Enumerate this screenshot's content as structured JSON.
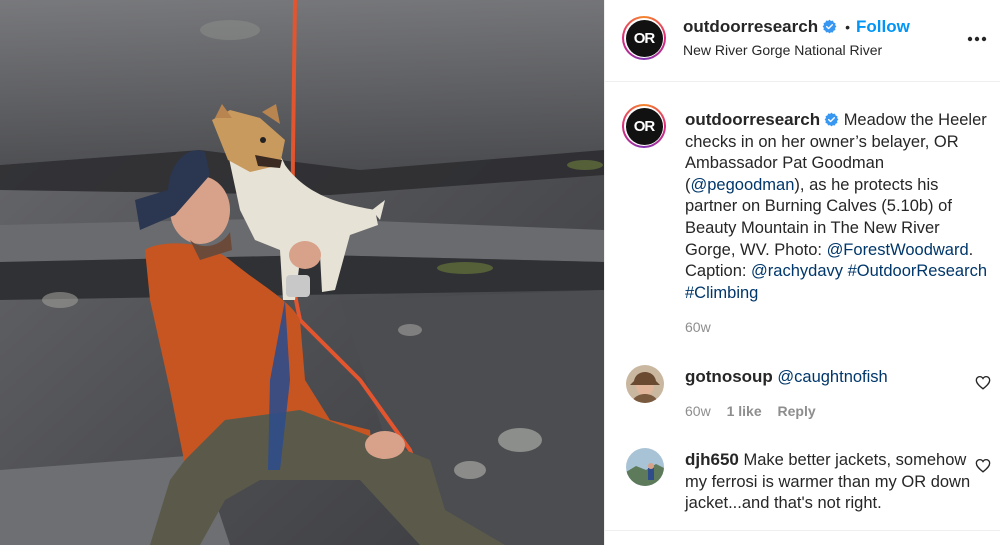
{
  "header": {
    "username": "outdoorresearch",
    "follow_label": "Follow",
    "location": "New River Gorge National River",
    "avatar_text": "OR"
  },
  "caption": {
    "username": "outdoorresearch",
    "text_1": "Meadow the Heeler checks in on her owner’s belayer, OR Ambassador Pat Goodman (",
    "mention_1": "@pegoodman",
    "text_2": "), as he  protects his partner on Burning Calves (5.10b) of Beauty Mountain in The New River Gorge, WV. Photo: ",
    "mention_2": "@ForestWoodward",
    "text_3": ". Caption: ",
    "mention_3": "@rachydavy",
    "hashtag_1": "#OutdoorResearch",
    "hashtag_2": "#Climbing",
    "time": "60w"
  },
  "comments": [
    {
      "username": "gotnosoup",
      "mention": "@caughtnofish",
      "time": "60w",
      "likes": "1 like",
      "reply_label": "Reply"
    },
    {
      "username": "djh650",
      "text": "Make better jackets, somehow my ferrosi is warmer than my OR down jacket...and that's not right."
    }
  ],
  "colors": {
    "accent": "#0095f6",
    "link": "#00376b",
    "muted": "#8e8e8e",
    "verified": "#3897f0"
  },
  "icons": {
    "verified": "verified-badge-icon",
    "more": "more-options-icon",
    "heart": "heart-outline-icon"
  }
}
